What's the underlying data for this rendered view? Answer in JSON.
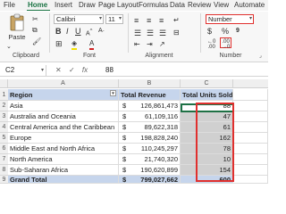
{
  "tabs": [
    "File",
    "Home",
    "Insert",
    "Draw",
    "Page Layout",
    "Formulas",
    "Data",
    "Review",
    "View",
    "Automate"
  ],
  "ribbon": {
    "font_name": "Calibri",
    "font_size": "11",
    "number_format": "Number",
    "groups": [
      "Clipboard",
      "Font",
      "Alignment",
      "Number"
    ],
    "paste_label": "Paste",
    "accent_color": "#1a7343",
    "highlight_color": "#e0302e"
  },
  "formula_bar": {
    "name_box": "C2",
    "value": "88"
  },
  "grid": {
    "columns": [
      "A",
      "B",
      "C"
    ],
    "header": {
      "row_num": "1",
      "region": "Region",
      "revenue": "Total Revenue",
      "units": "Total Units Sold"
    },
    "rows": [
      {
        "num": "2",
        "region": "Asia",
        "currency": "$",
        "revenue": "126,861,473",
        "units": "88"
      },
      {
        "num": "3",
        "region": "Australia and Oceania",
        "currency": "$",
        "revenue": "61,109,116",
        "units": "47"
      },
      {
        "num": "4",
        "region": "Central America and the Caribbean",
        "currency": "$",
        "revenue": "89,622,318",
        "units": "61"
      },
      {
        "num": "5",
        "region": "Europe",
        "currency": "$",
        "revenue": "198,828,240",
        "units": "162"
      },
      {
        "num": "6",
        "region": "Middle East and North Africa",
        "currency": "$",
        "revenue": "110,245,297",
        "units": "78"
      },
      {
        "num": "7",
        "region": "North America",
        "currency": "$",
        "revenue": "21,740,320",
        "units": "10"
      },
      {
        "num": "8",
        "region": "Sub-Saharan Africa",
        "currency": "$",
        "revenue": "190,620,899",
        "units": "154"
      }
    ],
    "total": {
      "num": "9",
      "label": "Grand Total",
      "currency": "$",
      "revenue": "799,027,662",
      "units": "600"
    }
  }
}
